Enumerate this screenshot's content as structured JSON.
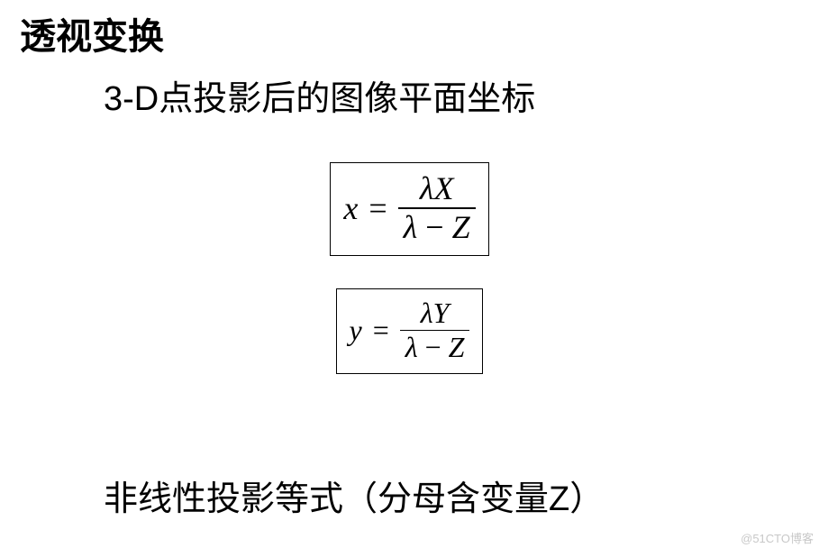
{
  "title": "透视变换",
  "subtitle": "3-D点投影后的图像平面坐标",
  "formula1": {
    "lhs": "x",
    "eq": "=",
    "num_lambda": "λ",
    "num_var": "X",
    "den_lambda": "λ",
    "den_minus": "−",
    "den_var": "Z"
  },
  "formula2": {
    "lhs": "y",
    "eq": "=",
    "num_lambda": "λ",
    "num_var": "Y",
    "den_lambda": "λ",
    "den_minus": "−",
    "den_var": "Z"
  },
  "bottom": "非线性投影等式（分母含变量Z）",
  "watermark": "@51CTO博客"
}
